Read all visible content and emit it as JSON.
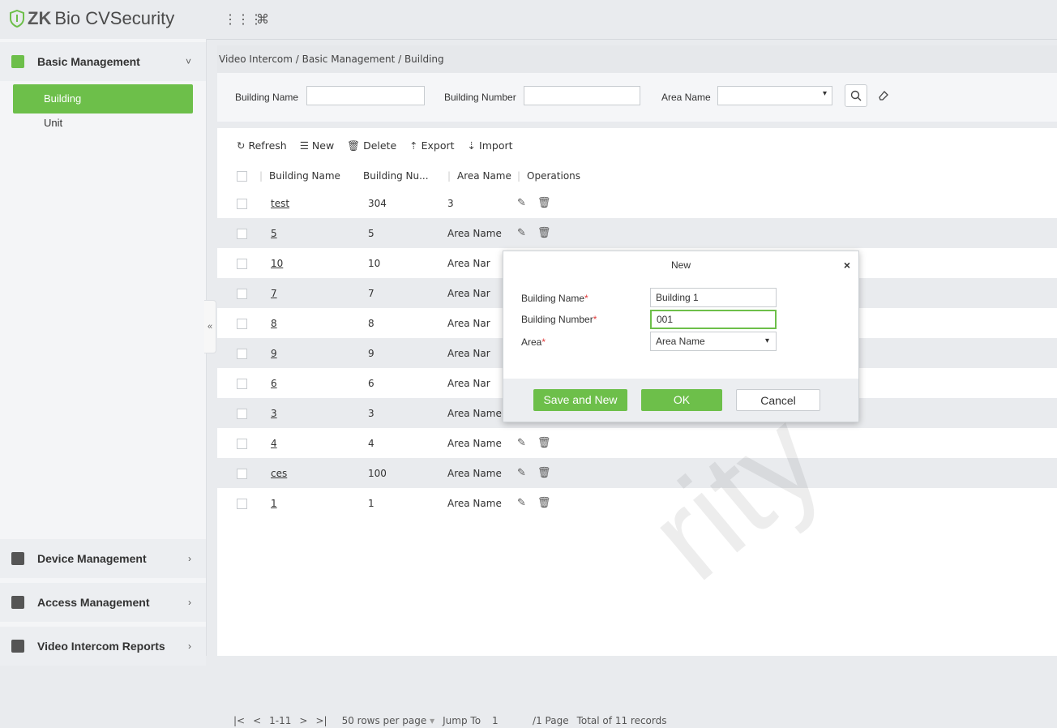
{
  "app": {
    "brand_zk": "ZK",
    "brand_rest": "Bio CVSecurity",
    "top_icons": [
      "grid-icon",
      "command-icon"
    ]
  },
  "sidebar": {
    "groups": [
      {
        "label": "Basic Management",
        "icon": "building-icon",
        "chevron": "˅"
      },
      {
        "label": "Device Management",
        "icon": "device-icon",
        "chevron": "›"
      },
      {
        "label": "Access Management",
        "icon": "access-icon",
        "chevron": "›"
      },
      {
        "label": "Video Intercom Reports",
        "icon": "report-icon",
        "chevron": "›"
      }
    ],
    "items": [
      {
        "label": "Building",
        "active": true
      },
      {
        "label": "Unit",
        "active": false
      }
    ],
    "collapse_glyph": "«"
  },
  "breadcrumb": "Video Intercom / Basic Management / Building",
  "filter": {
    "building_name_label": "Building Name",
    "building_number_label": "Building Number",
    "area_name_label": "Area Name",
    "building_name_value": "",
    "building_number_value": "",
    "area_name_value": ""
  },
  "toolbar": {
    "refresh": "Refresh",
    "new": "New",
    "delete": "Delete",
    "export": "Export",
    "import": "Import"
  },
  "table": {
    "headers": [
      "Building Name",
      "Building Nu...",
      "Area Name",
      "Operations"
    ],
    "rows": [
      {
        "name": "test",
        "number": "304",
        "area": "3"
      },
      {
        "name": "5",
        "number": "5",
        "area": "Area Name"
      },
      {
        "name": "10",
        "number": "10",
        "area": "Area Nar"
      },
      {
        "name": "7",
        "number": "7",
        "area": "Area Nar"
      },
      {
        "name": "8",
        "number": "8",
        "area": "Area Nar"
      },
      {
        "name": "9",
        "number": "9",
        "area": "Area Nar"
      },
      {
        "name": "6",
        "number": "6",
        "area": "Area Nar"
      },
      {
        "name": "3",
        "number": "3",
        "area": "Area Name"
      },
      {
        "name": "4",
        "number": "4",
        "area": "Area Name"
      },
      {
        "name": "ces",
        "number": "100",
        "area": "Area Name"
      },
      {
        "name": "1",
        "number": "1",
        "area": "Area Name"
      }
    ]
  },
  "pager": {
    "first": "|<",
    "prev": "<",
    "range": "1-11",
    "next": ">",
    "last": ">|",
    "rows_per_page": "50 rows per page",
    "jump_label": "Jump To",
    "jump_value": "1",
    "pages": "/1 Page",
    "total": "Total of 11 records"
  },
  "modal": {
    "title": "New",
    "close": "×",
    "fields": [
      {
        "label": "Building Name",
        "value": "Building 1"
      },
      {
        "label": "Building Number",
        "value": "001"
      },
      {
        "label": "Area",
        "value": "Area Name"
      }
    ],
    "required_mark": "*",
    "save_and_new": "Save and New",
    "ok": "OK",
    "cancel": "Cancel"
  },
  "colors": {
    "accent": "#6dbf4a",
    "required": "#e03c3c"
  }
}
